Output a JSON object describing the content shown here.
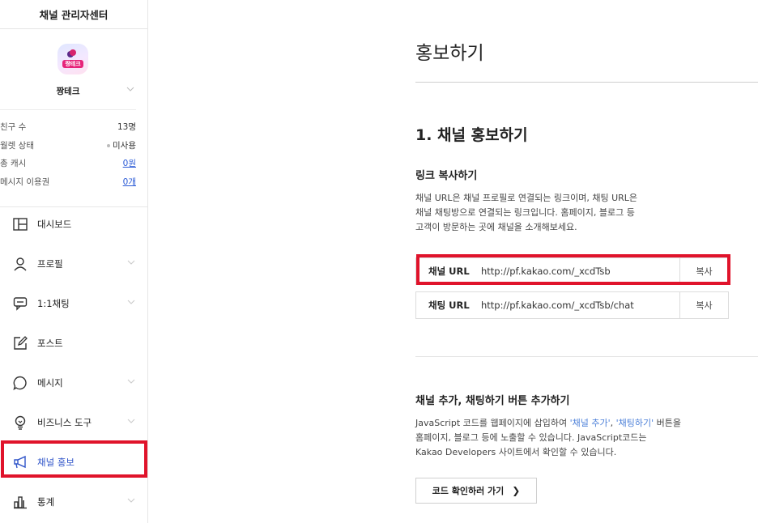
{
  "sidebar": {
    "header": "채널 관리자센터",
    "profile": {
      "name": "짱테크",
      "avatar_text": "짱테크"
    },
    "stats": [
      {
        "label": "친구 수",
        "value": "13명"
      },
      {
        "label": "월렛 상태",
        "value": "미사용"
      },
      {
        "label": "총 캐시",
        "value": "0원"
      },
      {
        "label": "메시지 이용권",
        "value": "0개"
      }
    ],
    "menu": [
      {
        "label": "대시보드",
        "icon": "dashboard-icon"
      },
      {
        "label": "프로필",
        "icon": "person-icon"
      },
      {
        "label": "1:1채팅",
        "icon": "chat-icon"
      },
      {
        "label": "포스트",
        "icon": "edit-icon"
      },
      {
        "label": "메시지",
        "icon": "speech-bubble-icon"
      },
      {
        "label": "비즈니스 도구",
        "icon": "lightbulb-icon"
      },
      {
        "label": "채널 홍보",
        "icon": "megaphone-icon"
      },
      {
        "label": "통계",
        "icon": "bar-chart-icon"
      }
    ]
  },
  "main": {
    "page_title": "홍보하기",
    "section1_title": "1. 채널 홍보하기",
    "link_copy": {
      "title": "링크 복사하기",
      "description": "채널 URL은 채널 프로필로 연결되는 링크이며, 채팅 URL은\n채널 채팅방으로 연결되는 링크입니다. 홈페이지, 블로그 등\n고객이 방문하는 곳에 채널을 소개해보세요.",
      "rows": [
        {
          "label": "채널 URL",
          "url": "http://pf.kakao.com/_xcdTsb",
          "copy": "복사"
        },
        {
          "label": "채팅 URL",
          "url": "http://pf.kakao.com/_xcdTsb/chat",
          "copy": "복사"
        }
      ]
    },
    "buttons_section": {
      "title": "채널 추가, 채팅하기 버튼 추가하기",
      "desc_pre": "JavaScript 코드를 웹페이지에 삽입하여 ",
      "desc_q1": "'채널 추가'",
      "desc_mid": ", ",
      "desc_q2": "'채팅하기'",
      "desc_post": " 버튼을\n홈페이지, 블로그 등에 노출할 수 있습니다. JavaScript코드는\nKakao Developers 사이트에서 확인할 수 있습니다.",
      "button_label": "코드 확인하러 가기",
      "button_arrow": "❯"
    }
  },
  "colors": {
    "highlight": "#e0132b",
    "active": "#2f54c9",
    "link": "#2b5bd6"
  }
}
